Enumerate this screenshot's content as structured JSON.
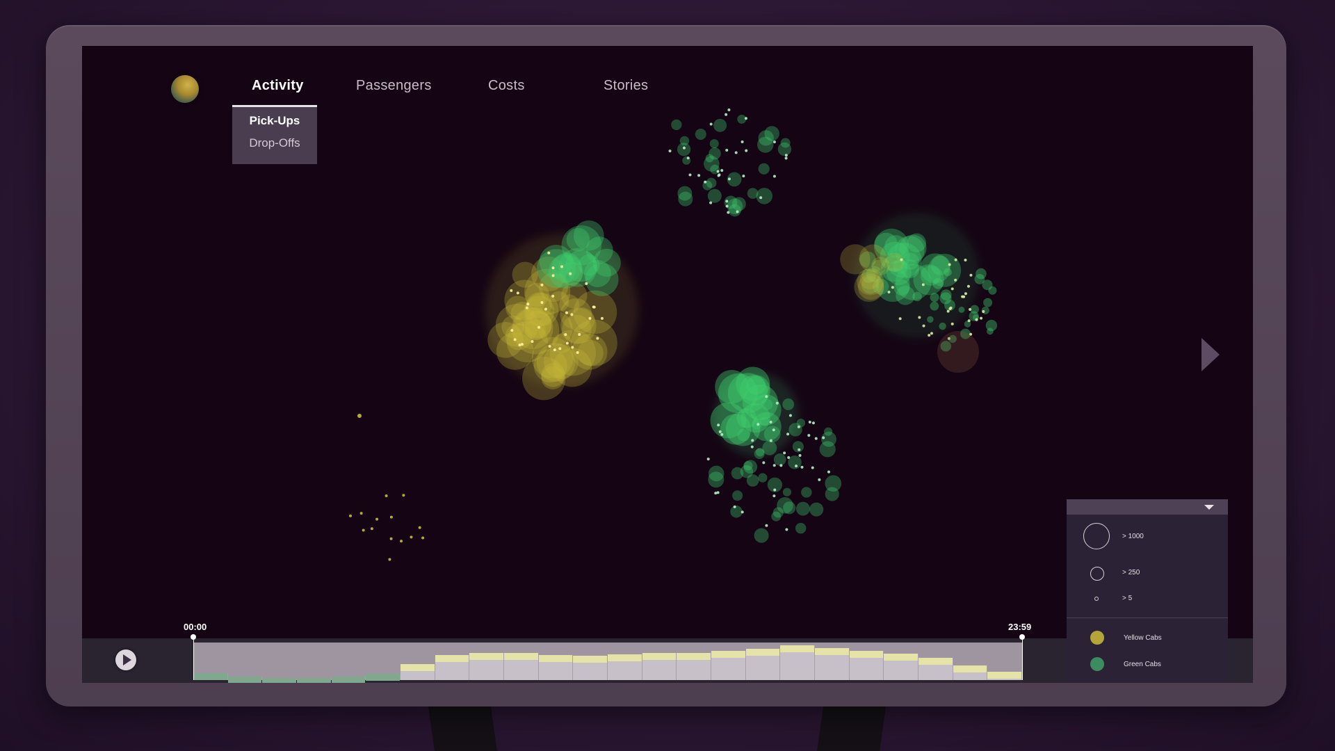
{
  "nav": {
    "tabs": [
      {
        "label": "Activity",
        "active": true
      },
      {
        "label": "Passengers",
        "active": false
      },
      {
        "label": "Costs",
        "active": false
      },
      {
        "label": "Stories",
        "active": false
      }
    ],
    "submenu": [
      {
        "label": "Pick-Ups",
        "active": true
      },
      {
        "label": "Drop-Offs",
        "active": false
      }
    ]
  },
  "timeline": {
    "start_label": "00:00",
    "end_label": "23:59",
    "play_icon": "play-icon",
    "histogram": [
      0.18,
      0.1,
      0.06,
      0.06,
      0.1,
      0.16,
      0.42,
      0.66,
      0.72,
      0.72,
      0.66,
      0.64,
      0.68,
      0.72,
      0.72,
      0.78,
      0.84,
      0.92,
      0.86,
      0.78,
      0.7,
      0.6,
      0.38,
      0.22
    ]
  },
  "legend": {
    "sizes": [
      {
        "label": "> 1000"
      },
      {
        "label": "> 250"
      },
      {
        "label": "> 5"
      }
    ],
    "series": [
      {
        "label": "Yellow Cabs",
        "color": "#b5a43a"
      },
      {
        "label": "Green Cabs",
        "color": "#3d8c5f"
      }
    ]
  },
  "colors": {
    "yellow": "#c9bb3b",
    "green": "#3fcf6f",
    "screen_bg": "#150514"
  }
}
